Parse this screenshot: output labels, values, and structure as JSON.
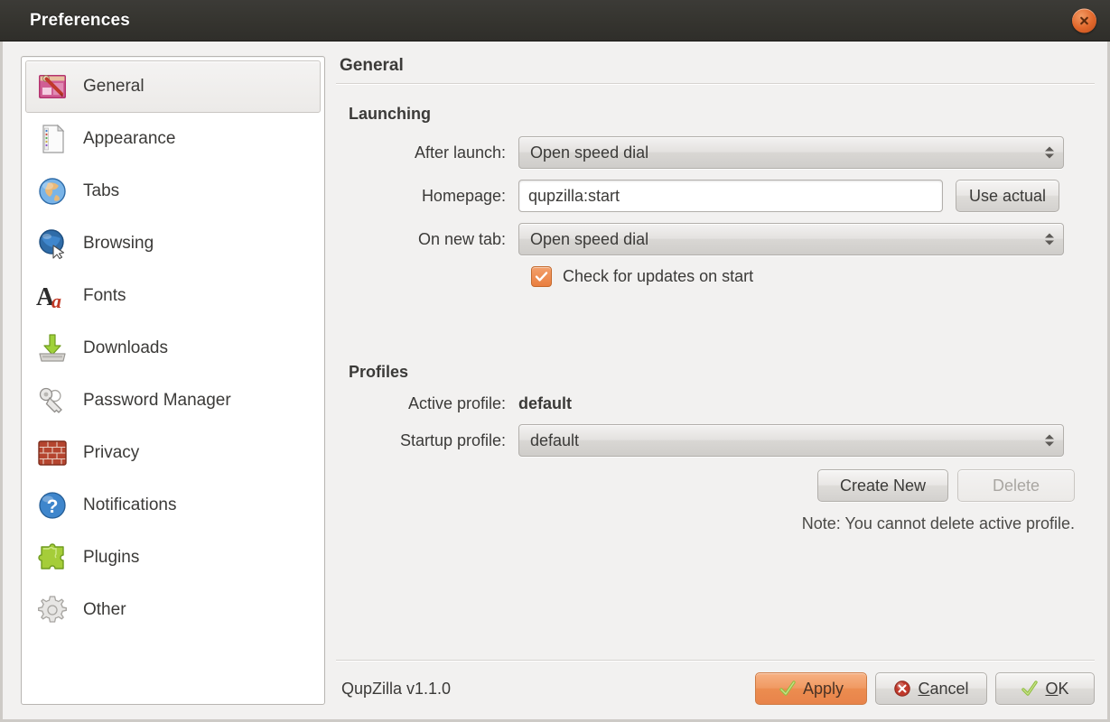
{
  "window": {
    "title": "Preferences",
    "close_icon": "close-icon",
    "accent_orange": "#e2682c",
    "titlebar_bg": "#35342f"
  },
  "sidebar": {
    "items": [
      {
        "label": "General",
        "icon": "general-preferences-icon",
        "selected": true
      },
      {
        "label": "Appearance",
        "icon": "appearance-document-icon",
        "selected": false
      },
      {
        "label": "Tabs",
        "icon": "globe-tabs-icon",
        "selected": false
      },
      {
        "label": "Browsing",
        "icon": "globe-cursor-icon",
        "selected": false
      },
      {
        "label": "Fonts",
        "icon": "fonts-aa-icon",
        "selected": false
      },
      {
        "label": "Downloads",
        "icon": "downloads-arrow-icon",
        "selected": false
      },
      {
        "label": "Password Manager",
        "icon": "keys-icon",
        "selected": false
      },
      {
        "label": "Privacy",
        "icon": "firewall-brick-icon",
        "selected": false
      },
      {
        "label": "Notifications",
        "icon": "question-bubble-icon",
        "selected": false
      },
      {
        "label": "Plugins",
        "icon": "puzzle-piece-icon",
        "selected": false
      },
      {
        "label": "Other",
        "icon": "gear-icon",
        "selected": false
      }
    ]
  },
  "main": {
    "title": "General",
    "launching": {
      "group_title": "Launching",
      "after_launch_label": "After launch:",
      "after_launch_value": "Open speed dial",
      "homepage_label": "Homepage:",
      "homepage_value": "qupzilla:start",
      "homepage_placeholder": "",
      "use_actual_label": "Use actual",
      "on_new_tab_label": "On new tab:",
      "on_new_tab_value": "Open speed dial",
      "check_updates_label": "Check for updates on start",
      "check_updates_checked": true
    },
    "profiles": {
      "group_title": "Profiles",
      "active_profile_label": "Active profile:",
      "active_profile_value": "default",
      "startup_profile_label": "Startup profile:",
      "startup_profile_value": "default",
      "create_new_label": "Create New",
      "delete_label": "Delete",
      "delete_disabled": true,
      "note": "Note: You cannot delete active profile."
    }
  },
  "footer": {
    "version": "QupZilla v1.1.0",
    "apply_label": "Apply",
    "cancel_label": "Cancel",
    "cancel_accel": "C",
    "cancel_rest": "ancel",
    "ok_accel": "O",
    "ok_rest": "K"
  }
}
